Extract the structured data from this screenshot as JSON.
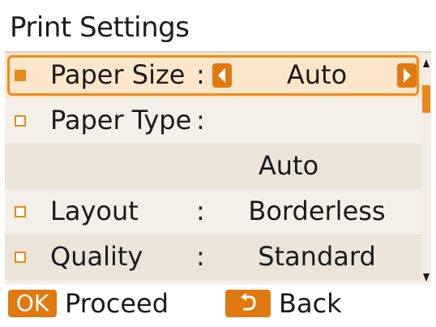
{
  "header": {
    "title": "Print Settings"
  },
  "settings": [
    {
      "label": "Paper Size",
      "colon": ":",
      "value": "Auto",
      "selected": true
    },
    {
      "label": "Paper Type",
      "colon": ":",
      "value": ""
    },
    {
      "label": "",
      "colon": "",
      "value": "Auto"
    },
    {
      "label": "Layout",
      "colon": ":",
      "value": "Borderless"
    },
    {
      "label": "Quality",
      "colon": ":",
      "value": "Standard"
    }
  ],
  "footer": {
    "ok_badge": "OK",
    "proceed_label": "Proceed",
    "back_label": "Back"
  },
  "icons": {
    "checkbox": "square-checkbox-icon",
    "left_arrow": "left-arrow-icon",
    "right_arrow": "right-arrow-icon",
    "scroll_up": "scroll-up-icon",
    "scroll_down": "scroll-down-icon",
    "back": "return-icon"
  },
  "colors": {
    "accent": "#e07a10",
    "selected_bg": "#fbe6cc",
    "row_alt": "#ece4d8",
    "row_plain": "#f4efe8"
  }
}
